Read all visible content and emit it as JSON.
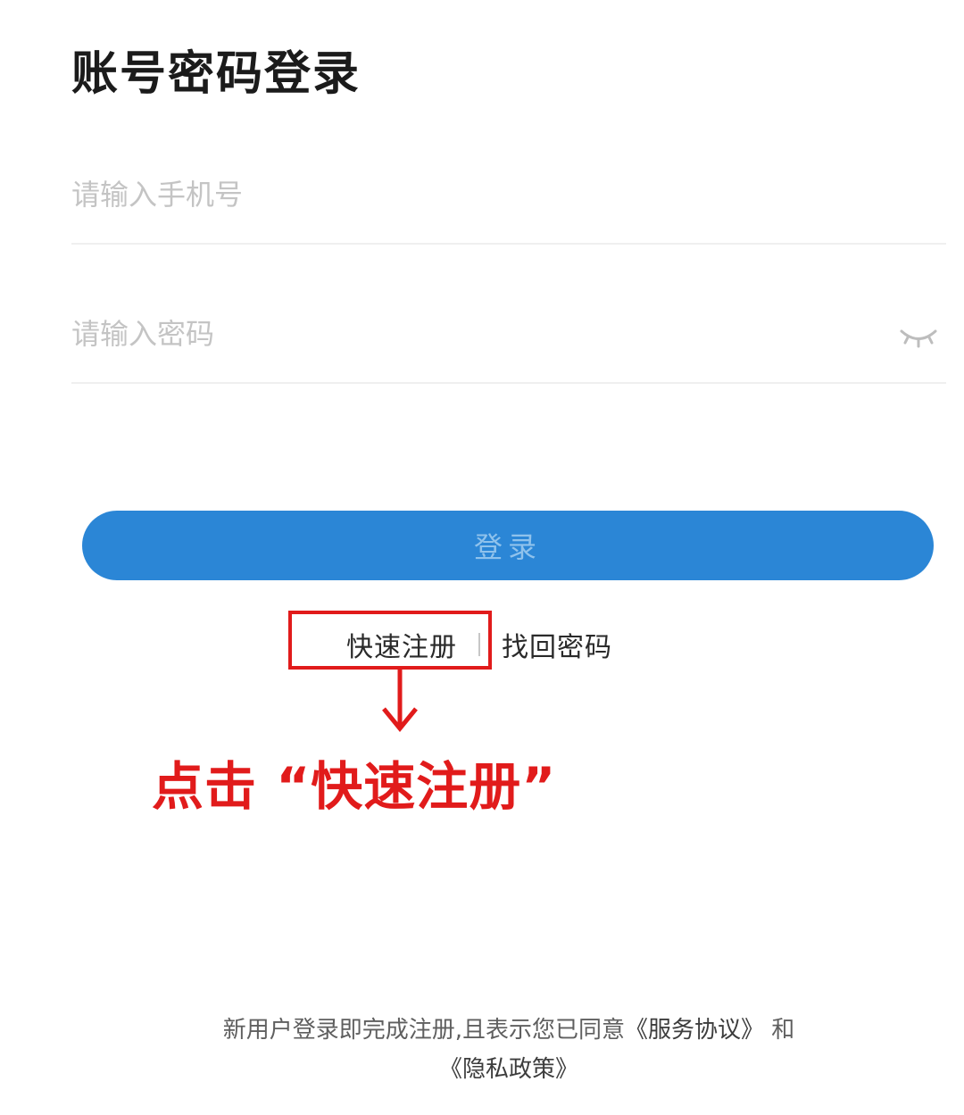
{
  "page": {
    "title": "账号密码登录"
  },
  "form": {
    "phone_placeholder": "请输入手机号",
    "phone_value": "",
    "password_placeholder": "请输入密码",
    "password_value": "",
    "password_toggle_icon": "eye-closed-icon",
    "login_label": "登录",
    "login_button_color": "#2b86d6"
  },
  "links": {
    "register_label": "快速注册",
    "recover_password_label": "找回密码"
  },
  "annotation": {
    "text": "点击  “快速注册”",
    "color": "#e11b1b"
  },
  "footer": {
    "prefix": "新用户登录即完成注册,且表示您已同意",
    "service_agreement": "《服务协议》",
    "conjunction": "和",
    "privacy_policy": "《隐私政策》"
  }
}
